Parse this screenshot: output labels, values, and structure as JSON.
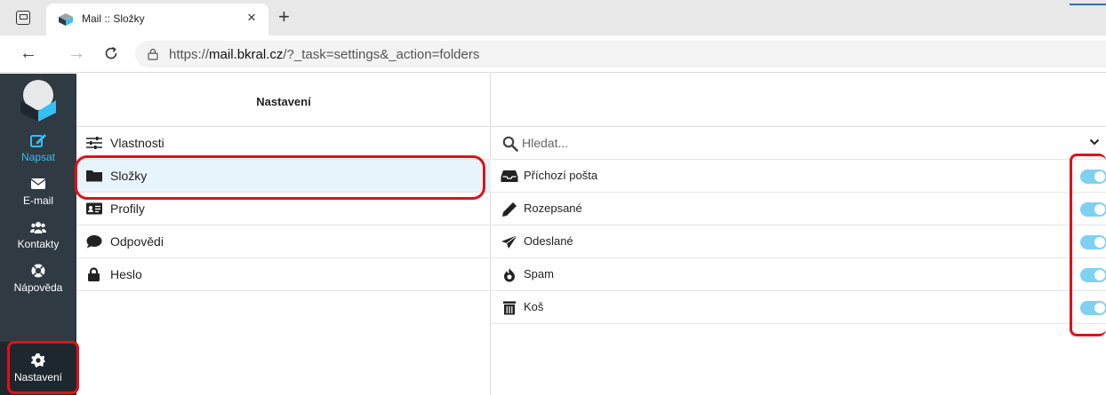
{
  "browser": {
    "tab_title": "Mail :: Složky",
    "tab_close": "×",
    "new_tab": "+",
    "url_prefix": "https://",
    "url_host": "mail.bkral.cz",
    "url_path": "/?_task=settings&_action=folders"
  },
  "rail": {
    "items": [
      {
        "label": "Napsat"
      },
      {
        "label": "E-mail"
      },
      {
        "label": "Kontakty"
      },
      {
        "label": "Nápověda"
      },
      {
        "label": "Nastavení"
      }
    ],
    "accent_color": "#37bef4"
  },
  "settings": {
    "title": "Nastavení",
    "items": [
      {
        "label": "Vlastnosti"
      },
      {
        "label": "Složky"
      },
      {
        "label": "Profily"
      },
      {
        "label": "Odpovědi"
      },
      {
        "label": "Heslo"
      }
    ]
  },
  "folders": {
    "search_placeholder": "Hledat...",
    "items": [
      {
        "label": "Příchozí pošta",
        "subscribed": true
      },
      {
        "label": "Rozepsané",
        "subscribed": true
      },
      {
        "label": "Odeslané",
        "subscribed": true
      },
      {
        "label": "Spam",
        "subscribed": true
      },
      {
        "label": "Koš",
        "subscribed": true
      }
    ],
    "toggle_color": "#7fd1f2"
  },
  "annotation_color": "#e0101a"
}
